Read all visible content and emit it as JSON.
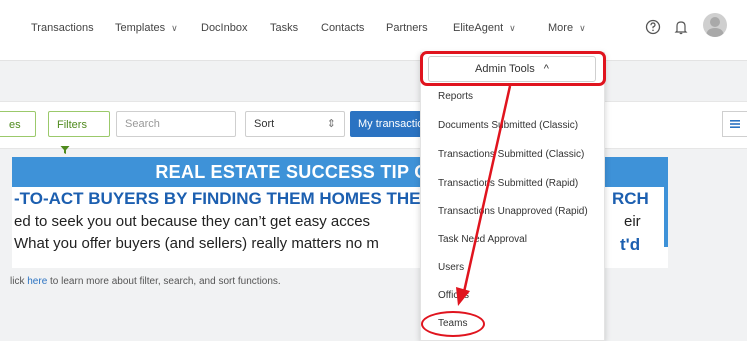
{
  "nav": {
    "items": [
      {
        "label": "Transactions"
      },
      {
        "label": "Templates"
      },
      {
        "label": "DocInbox"
      },
      {
        "label": "Tasks"
      },
      {
        "label": "Contacts"
      },
      {
        "label": "Partners"
      },
      {
        "label": "EliteAgent"
      },
      {
        "label": "More"
      }
    ],
    "icons": [
      "help-icon",
      "bell-icon",
      "avatar"
    ]
  },
  "toolbar": {
    "partial_button": "es",
    "filters_label": "Filters",
    "search_placeholder": "Search",
    "sort_label": "Sort",
    "sort_arrows": "⇕",
    "primary_label": "My transactio"
  },
  "banner": {
    "title": "REAL ESTATE SUCCESS TIP OF THE DAY",
    "line1": "-TO-ACT BUYERS BY FINDING THEM HOMES THE",
    "line2": "ed to seek you out because they can’t get easy acces",
    "line3": "What you offer buyers (and sellers) really matters no m",
    "right1": "RCH",
    "right2": "eir",
    "right3": "t'd"
  },
  "hint": {
    "prefix": "lick ",
    "link": "here",
    "suffix": " to learn more about filter, search, and sort functions."
  },
  "dropdown": {
    "header": "Admin Tools",
    "header_chevron": "^",
    "items": [
      {
        "label": "Reports"
      },
      {
        "label": "Documents Submitted (Classic)"
      },
      {
        "label": "Transactions Submitted (Classic)"
      },
      {
        "label": "Transactions Submitted (Rapid)"
      },
      {
        "label": "Transactions Unapproved (Rapid)"
      },
      {
        "label": "Task Need Approval"
      },
      {
        "label": "Users"
      },
      {
        "label": "Offices"
      },
      {
        "label": "Teams"
      }
    ]
  },
  "colors": {
    "accent_red": "#e0141e",
    "primary_blue": "#2b73c2",
    "filter_green": "#4f8a1d",
    "banner_blue": "#3e92d8"
  }
}
